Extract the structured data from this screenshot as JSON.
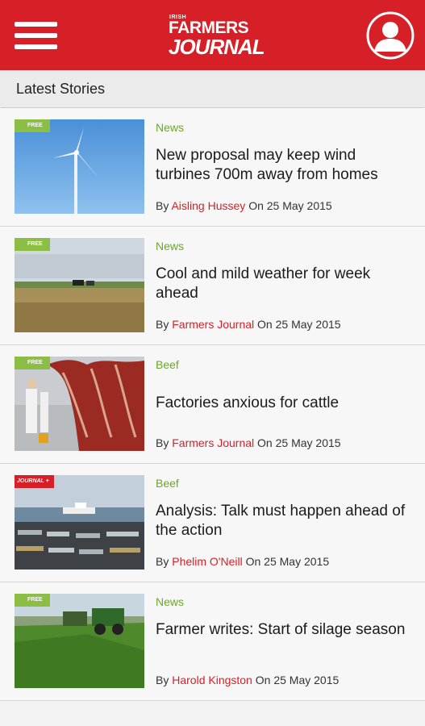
{
  "header": {
    "logo_small": "IRISH",
    "logo_main": "FARMERS",
    "logo_sub": "JOURNAL",
    "brand_color": "#d71f27"
  },
  "section": {
    "title": "Latest Stories"
  },
  "stories": [
    {
      "badge": "FREE",
      "category": "News",
      "headline": "New proposal may keep wind turbines 700m away from homes",
      "by": "By",
      "author": "Aisling Hussey",
      "date": "On 25 May 2015",
      "image": "wind-turbine"
    },
    {
      "badge": "FREE",
      "category": "News",
      "headline": "Cool and mild weather for week ahead",
      "by": "By",
      "author": "Farmers Journal",
      "date": "On 25 May 2015",
      "image": "field-cattle"
    },
    {
      "badge": "FREE",
      "category": "Beef",
      "headline": "Factories anxious for cattle",
      "by": "By",
      "author": "Farmers Journal",
      "date": "On 25 May 2015",
      "image": "meat-factory"
    },
    {
      "badge": "JOURNAL +",
      "category": "Beef",
      "headline": "Analysis: Talk must happen ahead of the action",
      "by": "By",
      "author": "Phelim O'Neill",
      "date": "On 25 May 2015",
      "image": "port-trailers"
    },
    {
      "badge": "FREE",
      "category": "News",
      "headline": "Farmer writes: Start of silage season",
      "by": "By",
      "author": "Harold Kingston",
      "date": "On 25 May 2015",
      "image": "silage-harvest"
    }
  ]
}
